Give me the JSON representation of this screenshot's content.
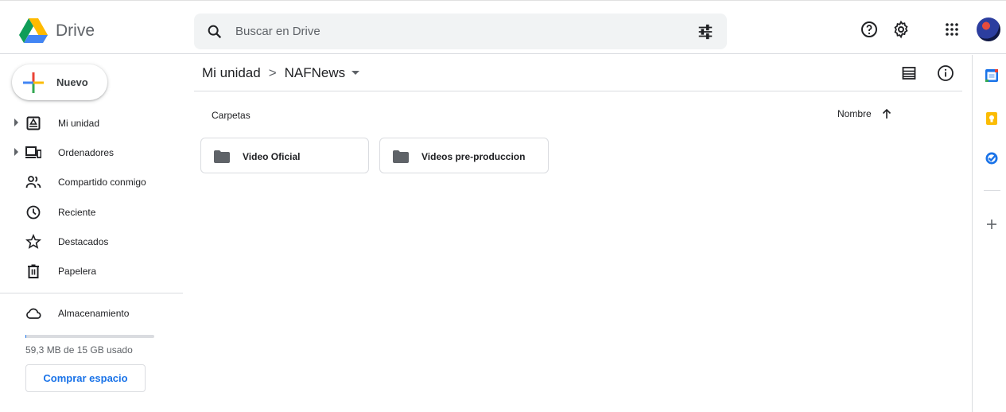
{
  "header": {
    "brand": "Drive",
    "search_placeholder": "Buscar en Drive"
  },
  "sidebar": {
    "new_label": "Nuevo",
    "items": [
      {
        "label": "Mi unidad",
        "icon": "my-drive-icon",
        "expandable": true
      },
      {
        "label": "Ordenadores",
        "icon": "computers-icon",
        "expandable": true
      },
      {
        "label": "Compartido conmigo",
        "icon": "shared-icon",
        "expandable": false
      },
      {
        "label": "Reciente",
        "icon": "clock-icon",
        "expandable": false
      },
      {
        "label": "Destacados",
        "icon": "star-icon",
        "expandable": false
      },
      {
        "label": "Papelera",
        "icon": "trash-icon",
        "expandable": false
      }
    ],
    "storage": {
      "label": "Almacenamiento",
      "usage_text": "59,3 MB de 15 GB usado",
      "usage_fraction": 0.004,
      "buy_label": "Comprar espacio"
    }
  },
  "main": {
    "breadcrumb": {
      "root": "Mi unidad",
      "separator": ">",
      "current": "NAFNews"
    },
    "section_label": "Carpetas",
    "sort_label": "Nombre",
    "folders": [
      {
        "name": "Video Oficial"
      },
      {
        "name": "Videos pre-produccion"
      }
    ]
  },
  "colors": {
    "accent": "#1a73e8",
    "folder_icon": "#5f6368",
    "text": "#202124"
  }
}
